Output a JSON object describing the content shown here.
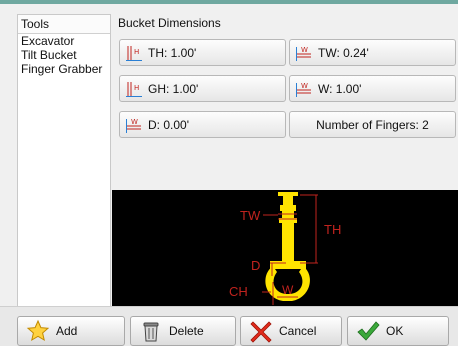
{
  "sidebar": {
    "header": "Tools",
    "items": [
      "Excavator",
      "Tilt Bucket",
      "Finger Grabber"
    ]
  },
  "panel": {
    "title": "Bucket Dimensions",
    "buttons": {
      "th": "TH: 1.00'",
      "tw": "TW: 0.24'",
      "gh": "GH: 1.00'",
      "w": "W: 1.00'",
      "d": "D: 0.00'",
      "fingers": "Number of Fingers: 2"
    }
  },
  "diagram": {
    "labels": {
      "tw": "TW",
      "th": "TH",
      "d": "D",
      "ch": "CH",
      "w": "W"
    },
    "colors": {
      "bucket": "#ffe400",
      "dimension": "#c0231e",
      "background": "#000000"
    }
  },
  "footer": {
    "add": "Add",
    "delete": "Delete",
    "cancel": "Cancel",
    "ok": "OK"
  },
  "icons": {
    "height": "height-dimension-icon",
    "width": "width-dimension-icon",
    "add": "star-icon",
    "delete": "trash-can-icon",
    "cancel": "red-x-icon",
    "ok": "green-check-icon"
  }
}
